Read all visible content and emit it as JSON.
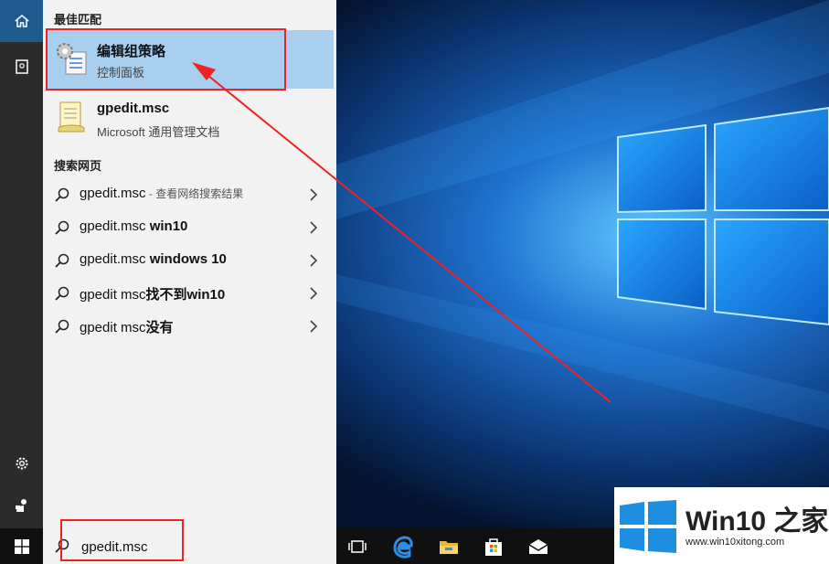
{
  "best_match": {
    "header": "最佳匹配",
    "title": "编辑组策略",
    "subtitle": "控制面板"
  },
  "file_result": {
    "title": "gpedit.msc",
    "subtitle": "Microsoft 通用管理文档"
  },
  "web": {
    "header": "搜索网页",
    "rows": [
      {
        "query": "gpedit.msc",
        "suffix": "",
        "hint": " - 查看网络搜索结果"
      },
      {
        "query": "gpedit.msc ",
        "suffix": "win10",
        "hint": ""
      },
      {
        "query": "gpedit.msc ",
        "suffix": "windows 10",
        "hint": ""
      },
      {
        "query": "gpedit msc",
        "suffix": "找不到win10",
        "hint": ""
      },
      {
        "query": "gpedit msc",
        "suffix": "没有",
        "hint": ""
      }
    ]
  },
  "search": {
    "value": "gpedit.msc"
  },
  "logo": {
    "brand": "Win10 之家",
    "url": "www.win10xitong.com"
  },
  "icons": {
    "rail": [
      "home-icon",
      "document-icon",
      "gear-icon",
      "user-icon"
    ],
    "taskbar": [
      "windows-start-icon",
      "task-view-icon",
      "edge-icon",
      "file-explorer-icon",
      "store-icon",
      "mail-icon"
    ]
  },
  "colors": {
    "selection": "#a8cfee",
    "annotation": "#e22222",
    "desktop_blue": "#1e6fd0"
  }
}
